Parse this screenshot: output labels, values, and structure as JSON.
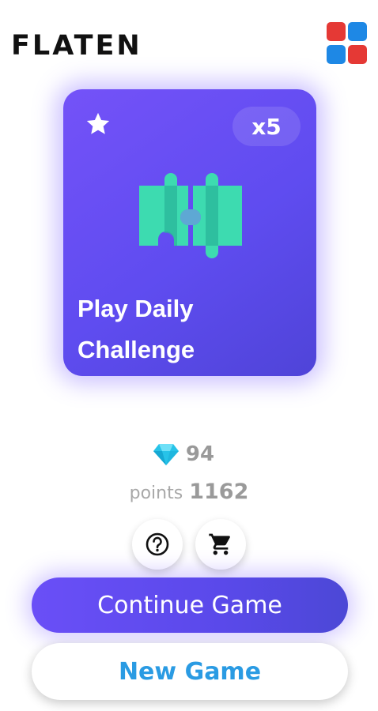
{
  "header": {
    "app_title": "FLATEN",
    "menu_icon": "grid-menu-icon",
    "menu_colors": [
      "#e53935",
      "#1e88e5",
      "#1e88e5",
      "#e53935"
    ]
  },
  "daily_card": {
    "title_line1": "Play Daily",
    "title_line2": "Challenge",
    "multiplier": "x5",
    "icons": [
      "star-icon",
      "puzzle-icon"
    ]
  },
  "stats": {
    "gems": "94",
    "gem_icon": "diamond-icon",
    "points_label": "points",
    "points": "1162"
  },
  "actions": {
    "help_icon": "help-icon",
    "shop_icon": "cart-icon",
    "continue_label": "Continue Game",
    "new_label": "New Game"
  },
  "colors": {
    "accent": "#6a4ff7",
    "new_game_text": "#2a9be3",
    "puzzle": "#3ddbb0"
  }
}
